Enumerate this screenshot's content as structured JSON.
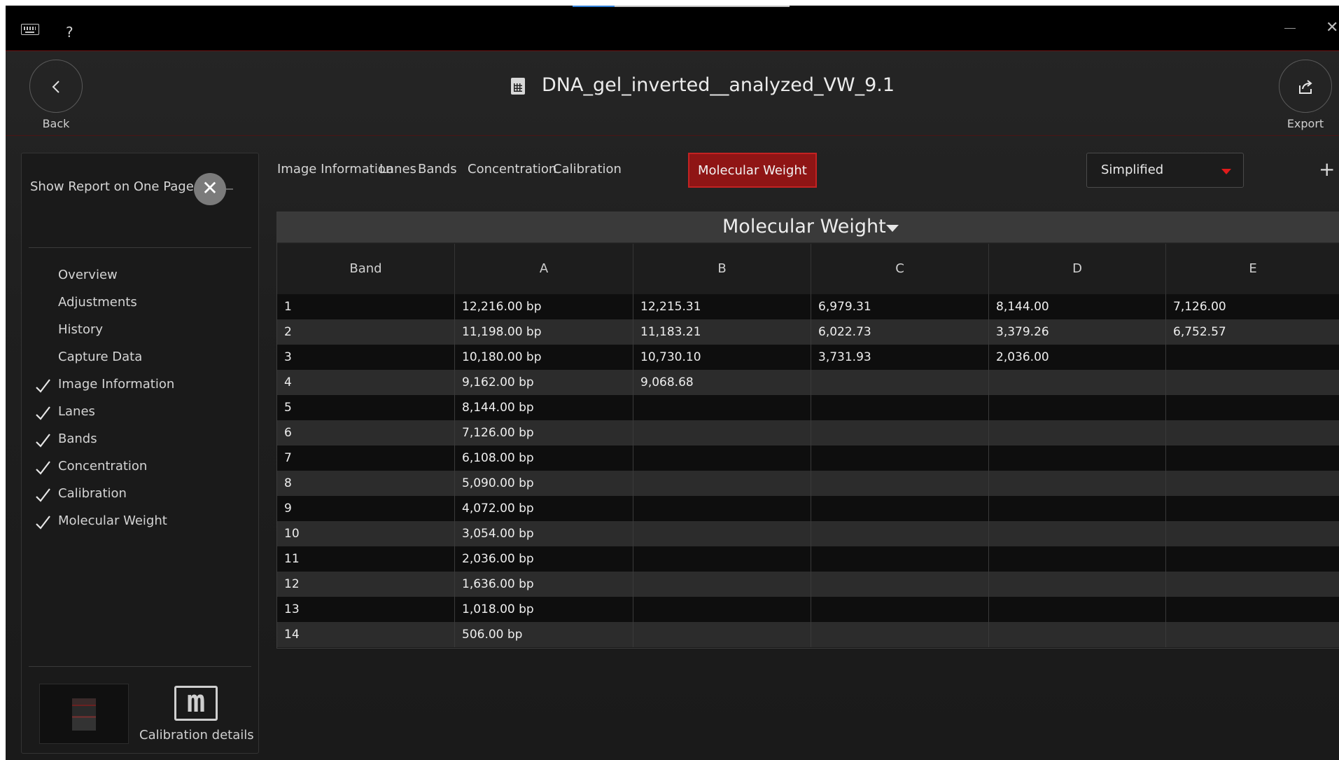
{
  "topbar": {
    "help": "?"
  },
  "header": {
    "title": "DNA_gel_inverted__analyzed_VW_9.1",
    "back_label": "Back",
    "export_label": "Export"
  },
  "sidebar": {
    "show_one_page_label": "Show Report on One Page",
    "toggle_glyph": "✕",
    "items": [
      {
        "label": "Overview",
        "checked": false
      },
      {
        "label": "Adjustments",
        "checked": false
      },
      {
        "label": "History",
        "checked": false
      },
      {
        "label": "Capture Data",
        "checked": false
      },
      {
        "label": "Image Information",
        "checked": true
      },
      {
        "label": "Lanes",
        "checked": true
      },
      {
        "label": "Bands",
        "checked": true
      },
      {
        "label": "Concentration",
        "checked": true
      },
      {
        "label": "Calibration",
        "checked": true
      },
      {
        "label": "Molecular Weight",
        "checked": true
      }
    ],
    "calibration_icon_letter": "m",
    "calibration_details_label": "Calibration details"
  },
  "tabs": [
    {
      "label": "Image Information",
      "active": false
    },
    {
      "label": "Lanes",
      "active": false
    },
    {
      "label": "Bands",
      "active": false
    },
    {
      "label": "Concentration",
      "active": false
    },
    {
      "label": "Calibration",
      "active": false
    },
    {
      "label": "Molecular Weight",
      "active": true
    }
  ],
  "mode_select": {
    "value": "Simplified"
  },
  "add_glyph": "+",
  "table": {
    "title": "Molecular Weight",
    "columns": [
      "Band",
      "A",
      "B",
      "C",
      "D",
      "E"
    ],
    "rows": [
      [
        "1",
        "12,216.00 bp",
        "12,215.31",
        "6,979.31",
        "8,144.00",
        "7,126.00"
      ],
      [
        "2",
        "11,198.00 bp",
        "11,183.21",
        "6,022.73",
        "3,379.26",
        "6,752.57"
      ],
      [
        "3",
        "10,180.00 bp",
        "10,730.10",
        "3,731.93",
        "2,036.00",
        ""
      ],
      [
        "4",
        "9,162.00 bp",
        "9,068.68",
        "",
        "",
        ""
      ],
      [
        "5",
        "8,144.00 bp",
        "",
        "",
        "",
        ""
      ],
      [
        "6",
        "7,126.00 bp",
        "",
        "",
        "",
        ""
      ],
      [
        "7",
        "6,108.00 bp",
        "",
        "",
        "",
        ""
      ],
      [
        "8",
        "5,090.00 bp",
        "",
        "",
        "",
        ""
      ],
      [
        "9",
        "4,072.00 bp",
        "",
        "",
        "",
        ""
      ],
      [
        "10",
        "3,054.00 bp",
        "",
        "",
        "",
        ""
      ],
      [
        "11",
        "2,036.00 bp",
        "",
        "",
        "",
        ""
      ],
      [
        "12",
        "1,636.00 bp",
        "",
        "",
        "",
        ""
      ],
      [
        "13",
        "1,018.00 bp",
        "",
        "",
        "",
        ""
      ],
      [
        "14",
        "506.00 bp",
        "",
        "",
        "",
        ""
      ]
    ]
  },
  "colors": {
    "accent": "#8f1515",
    "accent_border": "#c22222",
    "dropdown_arrow": "#e01b1b"
  }
}
